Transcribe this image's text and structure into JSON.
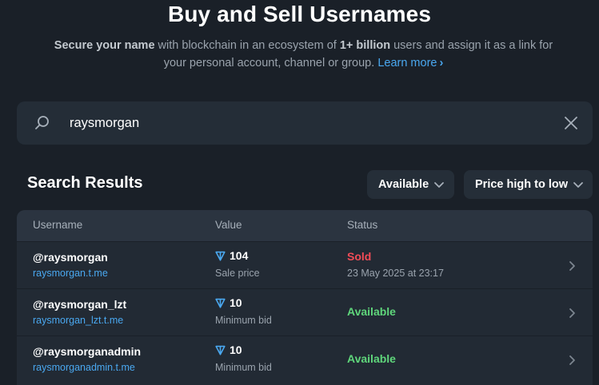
{
  "header": {
    "title": "Buy and Sell Usernames",
    "subtitle_bold1": "Secure your name",
    "subtitle_text1": " with blockchain in an ecosystem of ",
    "subtitle_bold2": "1+ billion",
    "subtitle_text2": " users and assign it as a link for your personal account, channel or group.",
    "learn_more": "Learn more"
  },
  "search": {
    "value": "raysmorgan",
    "icon": "search-icon",
    "clear_icon": "close-icon"
  },
  "results": {
    "title": "Search Results",
    "filter_label": "Available",
    "sort_label": "Price high to low"
  },
  "table": {
    "columns": [
      "Username",
      "Value",
      "Status"
    ],
    "rows": [
      {
        "name": "@raysmorgan",
        "link": "raysmorgan.t.me",
        "amount": "104",
        "value_label": "Sale price",
        "status": "Sold",
        "status_date": "23 May 2025 at 23:17"
      },
      {
        "name": "@raysmorgan_lzt",
        "link": "raysmorgan_lzt.t.me",
        "amount": "10",
        "value_label": "Minimum bid",
        "status": "Available",
        "status_date": ""
      },
      {
        "name": "@raysmorganadmin",
        "link": "raysmorganadmin.t.me",
        "amount": "10",
        "value_label": "Minimum bid",
        "status": "Available",
        "status_date": ""
      }
    ]
  },
  "colors": {
    "background": "#1a2028",
    "accent_link": "#4aa8f0",
    "sold": "#f24c57",
    "available": "#5fd67b"
  }
}
